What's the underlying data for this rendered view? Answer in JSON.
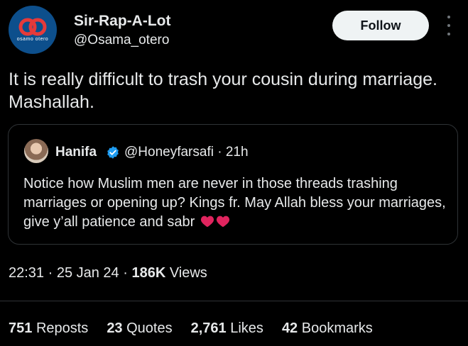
{
  "author": {
    "display_name": "Sir-Rap-A-Lot",
    "handle": "@Osama_otero",
    "avatar_text": "osamo otero"
  },
  "follow_label": "Follow",
  "tweet_text": "It is really difficult to trash your cousin during marriage. Mashallah.",
  "quote": {
    "name": "Hanifa",
    "handle_time": "@Honeyfarsafi · 21h",
    "text": "Notice how Muslim men are never in those threads trashing marriages or opening up? Kings fr. May Allah bless your marriages, give y’all patience and sabr"
  },
  "meta": {
    "time_date": "22:31 · 25 Jan 24 · ",
    "views_count": "186K",
    "views_label": " Views"
  },
  "stats": {
    "reposts_count": "751",
    "reposts_label": "Reposts",
    "quotes_count": "23",
    "quotes_label": "Quotes",
    "likes_count": "2,761",
    "likes_label": "Likes",
    "bookmarks_count": "42",
    "bookmarks_label": "Bookmarks"
  },
  "colors": {
    "background": "#000000",
    "text": "#e7e9ea",
    "verified": "#1d9bf0",
    "heart": "#e0245e",
    "border": "#2f3336"
  }
}
